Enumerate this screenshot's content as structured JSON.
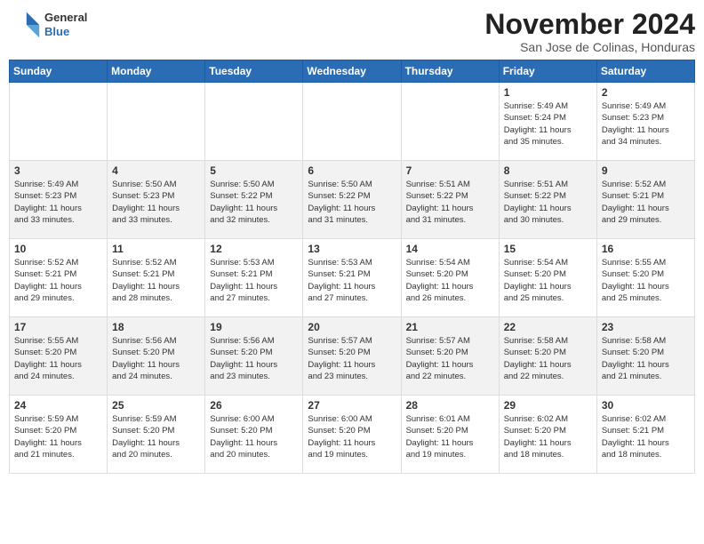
{
  "header": {
    "logo": {
      "general": "General",
      "blue": "Blue"
    },
    "month": "November 2024",
    "location": "San Jose de Colinas, Honduras"
  },
  "calendar": {
    "weekdays": [
      "Sunday",
      "Monday",
      "Tuesday",
      "Wednesday",
      "Thursday",
      "Friday",
      "Saturday"
    ],
    "rows": [
      [
        {
          "day": "",
          "info": ""
        },
        {
          "day": "",
          "info": ""
        },
        {
          "day": "",
          "info": ""
        },
        {
          "day": "",
          "info": ""
        },
        {
          "day": "",
          "info": ""
        },
        {
          "day": "1",
          "info": "Sunrise: 5:49 AM\nSunset: 5:24 PM\nDaylight: 11 hours\nand 35 minutes."
        },
        {
          "day": "2",
          "info": "Sunrise: 5:49 AM\nSunset: 5:23 PM\nDaylight: 11 hours\nand 34 minutes."
        }
      ],
      [
        {
          "day": "3",
          "info": "Sunrise: 5:49 AM\nSunset: 5:23 PM\nDaylight: 11 hours\nand 33 minutes."
        },
        {
          "day": "4",
          "info": "Sunrise: 5:50 AM\nSunset: 5:23 PM\nDaylight: 11 hours\nand 33 minutes."
        },
        {
          "day": "5",
          "info": "Sunrise: 5:50 AM\nSunset: 5:22 PM\nDaylight: 11 hours\nand 32 minutes."
        },
        {
          "day": "6",
          "info": "Sunrise: 5:50 AM\nSunset: 5:22 PM\nDaylight: 11 hours\nand 31 minutes."
        },
        {
          "day": "7",
          "info": "Sunrise: 5:51 AM\nSunset: 5:22 PM\nDaylight: 11 hours\nand 31 minutes."
        },
        {
          "day": "8",
          "info": "Sunrise: 5:51 AM\nSunset: 5:22 PM\nDaylight: 11 hours\nand 30 minutes."
        },
        {
          "day": "9",
          "info": "Sunrise: 5:52 AM\nSunset: 5:21 PM\nDaylight: 11 hours\nand 29 minutes."
        }
      ],
      [
        {
          "day": "10",
          "info": "Sunrise: 5:52 AM\nSunset: 5:21 PM\nDaylight: 11 hours\nand 29 minutes."
        },
        {
          "day": "11",
          "info": "Sunrise: 5:52 AM\nSunset: 5:21 PM\nDaylight: 11 hours\nand 28 minutes."
        },
        {
          "day": "12",
          "info": "Sunrise: 5:53 AM\nSunset: 5:21 PM\nDaylight: 11 hours\nand 27 minutes."
        },
        {
          "day": "13",
          "info": "Sunrise: 5:53 AM\nSunset: 5:21 PM\nDaylight: 11 hours\nand 27 minutes."
        },
        {
          "day": "14",
          "info": "Sunrise: 5:54 AM\nSunset: 5:20 PM\nDaylight: 11 hours\nand 26 minutes."
        },
        {
          "day": "15",
          "info": "Sunrise: 5:54 AM\nSunset: 5:20 PM\nDaylight: 11 hours\nand 25 minutes."
        },
        {
          "day": "16",
          "info": "Sunrise: 5:55 AM\nSunset: 5:20 PM\nDaylight: 11 hours\nand 25 minutes."
        }
      ],
      [
        {
          "day": "17",
          "info": "Sunrise: 5:55 AM\nSunset: 5:20 PM\nDaylight: 11 hours\nand 24 minutes."
        },
        {
          "day": "18",
          "info": "Sunrise: 5:56 AM\nSunset: 5:20 PM\nDaylight: 11 hours\nand 24 minutes."
        },
        {
          "day": "19",
          "info": "Sunrise: 5:56 AM\nSunset: 5:20 PM\nDaylight: 11 hours\nand 23 minutes."
        },
        {
          "day": "20",
          "info": "Sunrise: 5:57 AM\nSunset: 5:20 PM\nDaylight: 11 hours\nand 23 minutes."
        },
        {
          "day": "21",
          "info": "Sunrise: 5:57 AM\nSunset: 5:20 PM\nDaylight: 11 hours\nand 22 minutes."
        },
        {
          "day": "22",
          "info": "Sunrise: 5:58 AM\nSunset: 5:20 PM\nDaylight: 11 hours\nand 22 minutes."
        },
        {
          "day": "23",
          "info": "Sunrise: 5:58 AM\nSunset: 5:20 PM\nDaylight: 11 hours\nand 21 minutes."
        }
      ],
      [
        {
          "day": "24",
          "info": "Sunrise: 5:59 AM\nSunset: 5:20 PM\nDaylight: 11 hours\nand 21 minutes."
        },
        {
          "day": "25",
          "info": "Sunrise: 5:59 AM\nSunset: 5:20 PM\nDaylight: 11 hours\nand 20 minutes."
        },
        {
          "day": "26",
          "info": "Sunrise: 6:00 AM\nSunset: 5:20 PM\nDaylight: 11 hours\nand 20 minutes."
        },
        {
          "day": "27",
          "info": "Sunrise: 6:00 AM\nSunset: 5:20 PM\nDaylight: 11 hours\nand 19 minutes."
        },
        {
          "day": "28",
          "info": "Sunrise: 6:01 AM\nSunset: 5:20 PM\nDaylight: 11 hours\nand 19 minutes."
        },
        {
          "day": "29",
          "info": "Sunrise: 6:02 AM\nSunset: 5:20 PM\nDaylight: 11 hours\nand 18 minutes."
        },
        {
          "day": "30",
          "info": "Sunrise: 6:02 AM\nSunset: 5:21 PM\nDaylight: 11 hours\nand 18 minutes."
        }
      ]
    ]
  }
}
